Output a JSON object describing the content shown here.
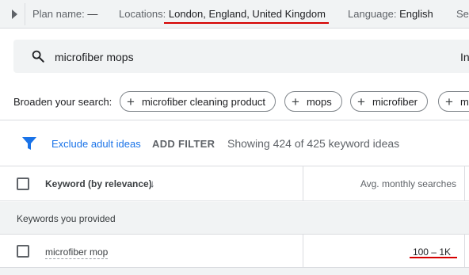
{
  "plan_bar": {
    "plan_name_label": "Plan name:",
    "plan_name_value": "—",
    "locations_label": "Locations:",
    "locations_value": "London, England, United Kingdom",
    "language_label": "Language:",
    "language_value": "English",
    "search_networks_label": "Sea"
  },
  "search": {
    "query": "microfiber mops",
    "right_text": "In"
  },
  "broaden": {
    "label": "Broaden your search:",
    "chips": [
      "microfiber cleaning product",
      "mops",
      "microfiber",
      "m"
    ]
  },
  "filters": {
    "exclude_adult": "Exclude adult ideas",
    "add_filter": "ADD FILTER",
    "showing": "Showing 424 of 425 keyword ideas"
  },
  "table": {
    "col_keyword": "Keyword (by relevance)",
    "col_avg": "Avg. monthly searches",
    "group_label": "Keywords you provided",
    "rows": [
      {
        "keyword": "microfiber mop",
        "avg": "100 – 1K"
      }
    ]
  },
  "colors": {
    "accent": "#1a73e8",
    "highlight_underline": "#d50000",
    "surface": "#f1f3f4"
  }
}
